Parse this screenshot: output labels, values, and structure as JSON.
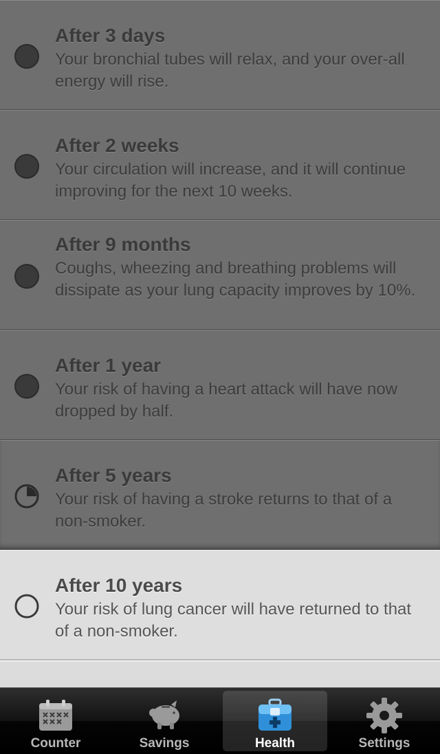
{
  "milestones": [
    {
      "title": "After 3 days",
      "desc": "Your bronchial tubes will relax, and your over-all energy will rise.",
      "progress": 1.0
    },
    {
      "title": "After 2 weeks",
      "desc": "Your circulation will increase, and it will continue improving for the next 10 weeks.",
      "progress": 1.0
    },
    {
      "title": "After 9 months",
      "desc": "Coughs, wheezing and breathing problems will dissipate as your lung capacity improves by 10%.",
      "progress": 1.0
    },
    {
      "title": "After 1 year",
      "desc": "Your risk of having a heart attack will have now dropped by half.",
      "progress": 1.0
    },
    {
      "title": "After 5 years",
      "desc": "Your risk of having a stroke returns to that of a non-smoker.",
      "progress": 0.25
    },
    {
      "title": "After 10 years",
      "desc": "Your risk of lung cancer will have returned to that of a non-smoker.",
      "progress": 0.0
    }
  ],
  "tabbar": {
    "tabs": [
      {
        "label": "Counter",
        "icon": "calendar-icon"
      },
      {
        "label": "Savings",
        "icon": "piggy-bank-icon"
      },
      {
        "label": "Health",
        "icon": "first-aid-kit-icon",
        "active": true
      },
      {
        "label": "Settings",
        "icon": "gear-icon"
      }
    ]
  },
  "colors": {
    "completed_row": "#6f6f6f",
    "pending_row": "#dedede",
    "active_icon": "#3fa3e8"
  }
}
